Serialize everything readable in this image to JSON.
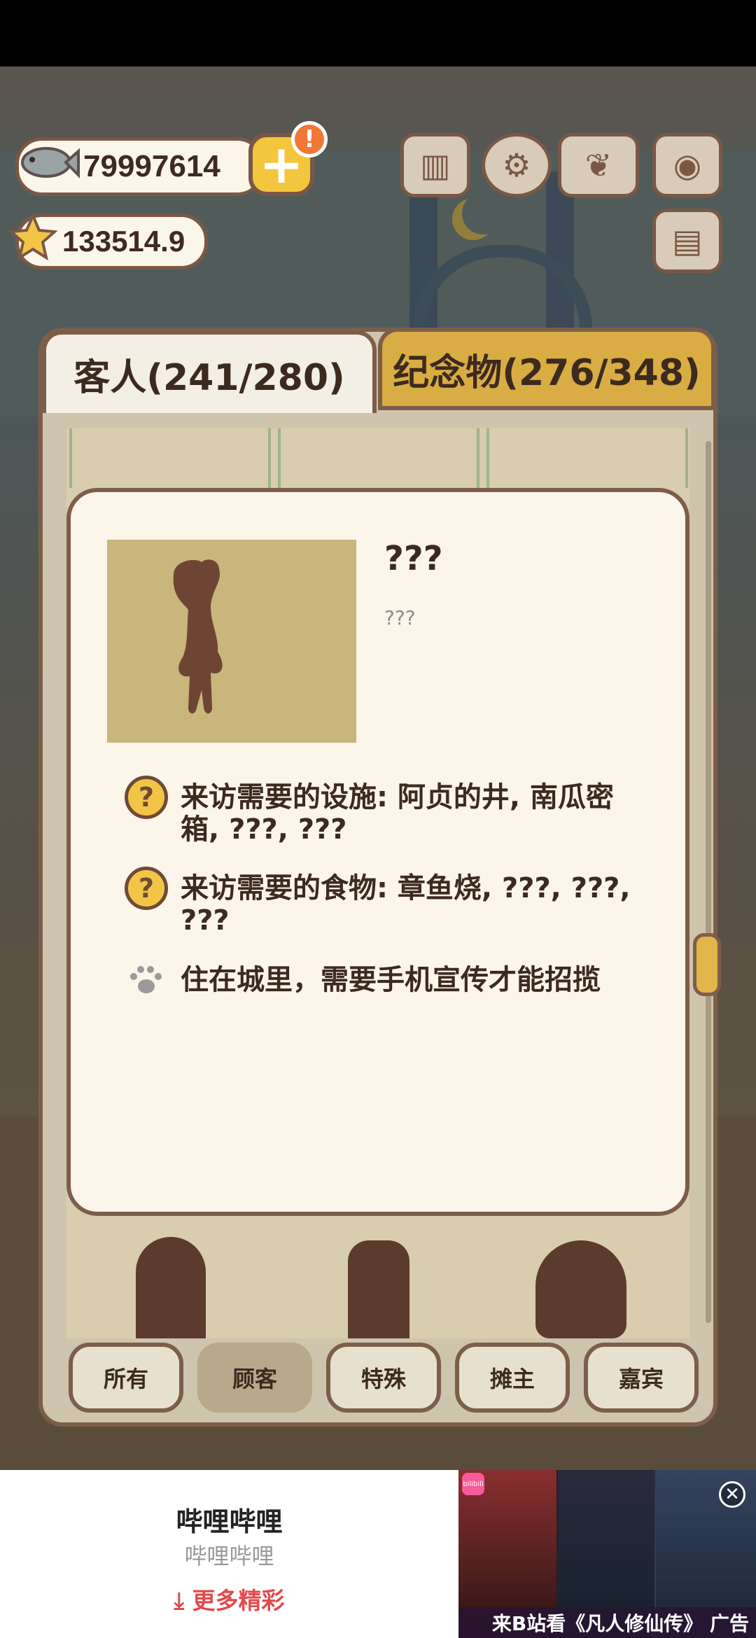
{
  "currencies": {
    "fish": {
      "icon": "fish-icon",
      "value": "79997614"
    },
    "stars": {
      "icon": "star-icon",
      "value": "133514.9"
    }
  },
  "top_icons": [
    "ranking-icon",
    "settings-gear-icon",
    "paw-book-icon",
    "camera-icon",
    "newspaper-icon"
  ],
  "tabs": {
    "guests": "客人(241/280)",
    "souvenirs": "纪念物(276/348)"
  },
  "filters": [
    {
      "label": "所有",
      "selected": false
    },
    {
      "label": "顾客",
      "selected": true
    },
    {
      "label": "特殊",
      "selected": false
    },
    {
      "label": "摊主",
      "selected": false
    },
    {
      "label": "嘉宾",
      "selected": false
    }
  ],
  "detail": {
    "name": "???",
    "description": "???",
    "facilities": "来访需要的设施: 阿贞的井, 南瓜密箱, ???, ???",
    "foods": "来访需要的食物: 章鱼烧, ???, ???, ???",
    "note": "住在城里，需要手机宣传才能招揽"
  },
  "ad": {
    "title": "哔哩哔哩",
    "subtitle": "哔哩哔哩",
    "cta": "更多精彩",
    "caption": "来B站看《凡人修仙传》 广告",
    "logo_text": "bilibili"
  },
  "colors": {
    "accent_yellow": "#f2c547",
    "brown": "#7d5e4a",
    "cream": "#fbf5ea",
    "ad_cta": "#e14a4a"
  }
}
